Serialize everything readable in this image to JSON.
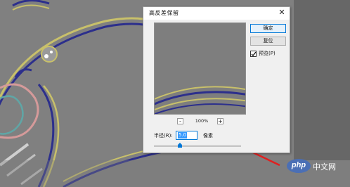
{
  "dialog": {
    "title": "高反差保留",
    "close_symbol": "✕",
    "ok_label": "确定",
    "reset_label": "复位",
    "preview_checkbox": {
      "label": "预览(P)",
      "checked": true
    },
    "zoom": {
      "minus": "-",
      "plus": "+",
      "level": "100%"
    },
    "radius": {
      "label": "半径(R):",
      "value": "5.0",
      "unit": "像素",
      "slider_fraction": 0.3
    }
  },
  "watermark": {
    "brand": "php",
    "text": "中文网"
  },
  "icons": [
    "close-icon",
    "checkmark-icon",
    "slider-thumb-icon",
    "arrow-annotation"
  ],
  "colors": {
    "canvas_gray": "#808080",
    "outline_yellow": "#c8c06a",
    "outline_blue": "#2c2f8c",
    "outline_pink": "#d59a9a",
    "outline_teal": "#5fa6a6",
    "arrow_red": "#e02020",
    "accent_blue": "#0078d7",
    "php_blue": "#4b6fb5"
  }
}
